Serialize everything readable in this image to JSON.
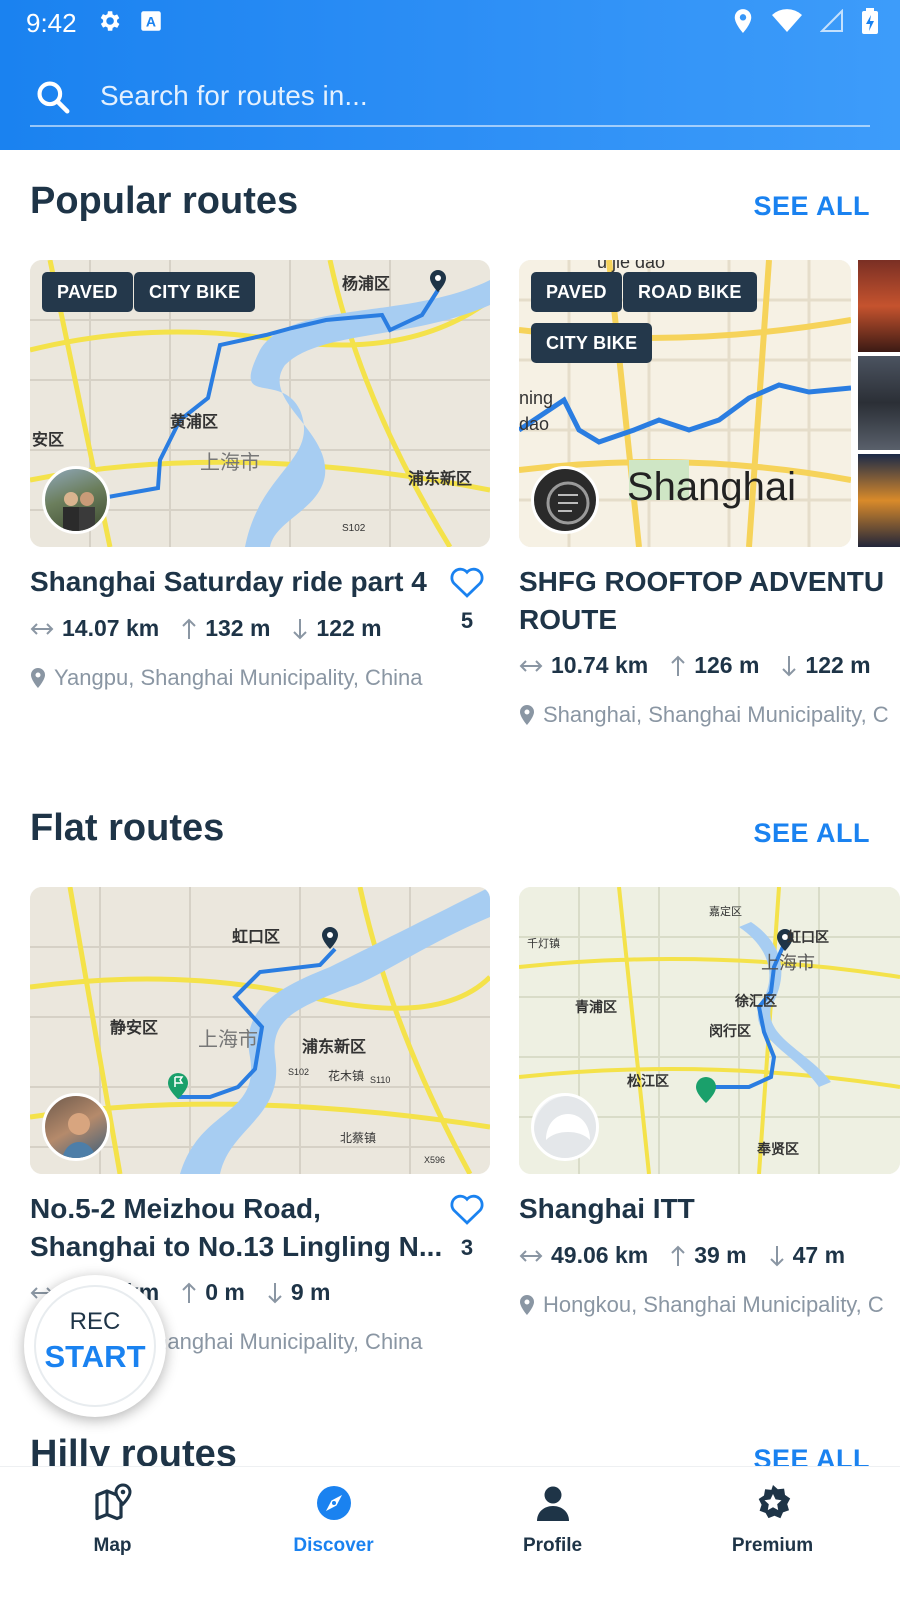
{
  "status_bar": {
    "time": "9:42"
  },
  "search": {
    "placeholder": "Search for routes in..."
  },
  "sections": [
    {
      "title": "Popular routes",
      "see_all": "SEE ALL",
      "cards": [
        {
          "tags": [
            "PAVED",
            "CITY BIKE"
          ],
          "title_lines": [
            "Shanghai Saturday ride part 4"
          ],
          "distance": "14.07 km",
          "ascent": "132 m",
          "descent": "122 m",
          "location": "Yangpu, Shanghai Municipality, China",
          "likes": "5",
          "map_labels": [
            "杨浦区",
            "黄浦区",
            "安区",
            "上海市",
            "浦东新区",
            "S102"
          ]
        },
        {
          "tags": [
            "PAVED",
            "ROAD BIKE",
            "CITY BIKE"
          ],
          "title_lines": [
            "SHFG ROOFTOP ADVENTU",
            "ROUTE"
          ],
          "distance": "10.74 km",
          "ascent": "126 m",
          "descent": "122 m",
          "location": "Shanghai, Shanghai Municipality, C",
          "map_labels": [
            "Shanghai",
            "ning",
            "dao",
            "u jie dao"
          ]
        }
      ]
    },
    {
      "title": "Flat routes",
      "see_all": "SEE ALL",
      "cards": [
        {
          "title_lines": [
            "No.5-2 Meizhou Road,",
            "Shanghai to No.13 Lingling N..."
          ],
          "distance": "16.88 km",
          "ascent": "0 m",
          "descent": "9 m",
          "location": "Yangpu, Shanghai Municipality, China",
          "likes": "3",
          "map_labels": [
            "虹口区",
            "静安区",
            "上海市",
            "浦东新区",
            "花木镇",
            "北蔡镇",
            "S102",
            "S110",
            "X596"
          ]
        },
        {
          "title_lines": [
            "Shanghai ITT"
          ],
          "distance": "49.06 km",
          "ascent": "39 m",
          "descent": "47 m",
          "location": "Hongkou, Shanghai Municipality, C",
          "map_labels": [
            "虹口区",
            "上海市",
            "青浦区",
            "徐汇区",
            "闵行区",
            "松江区",
            "奉贤区",
            "千灯镇",
            "嘉定区"
          ]
        }
      ]
    },
    {
      "title": "Hilly routes",
      "see_all": "SEE ALL"
    }
  ],
  "rec_button": {
    "label": "REC",
    "action": "START"
  },
  "bottom_nav": [
    {
      "label": "Map",
      "icon": "map-pin-icon",
      "active": false
    },
    {
      "label": "Discover",
      "icon": "compass-icon",
      "active": true
    },
    {
      "label": "Profile",
      "icon": "person-icon",
      "active": false
    },
    {
      "label": "Premium",
      "icon": "star-badge-icon",
      "active": false
    }
  ],
  "colors": {
    "accent": "#1a82f0",
    "dark": "#1e3447",
    "muted": "#8a96a3",
    "tag_bg": "#24384b",
    "route_line": "#2a7de1"
  }
}
